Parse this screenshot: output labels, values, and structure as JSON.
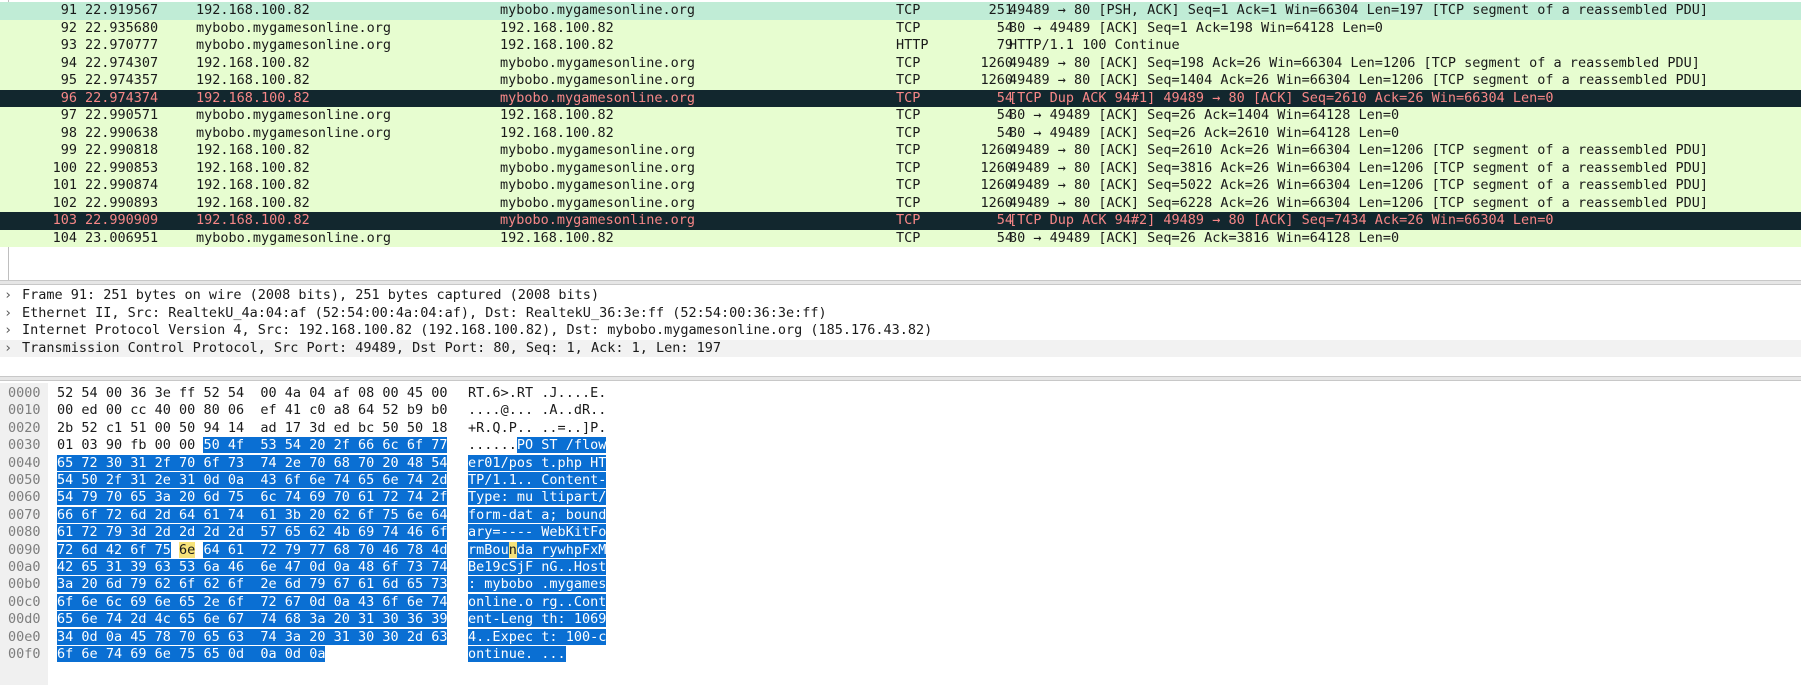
{
  "packet_list": {
    "rows": [
      {
        "no": "91",
        "time": "22.919567",
        "src": "192.168.100.82",
        "dst": "mybobo.mygamesonline.org",
        "proto": "TCP",
        "len": "251",
        "info": "49489 → 80 [PSH, ACK] Seq=1 Ack=1 Win=66304 Len=197 [TCP segment of a reassembled PDU]",
        "style": "sel"
      },
      {
        "no": "92",
        "time": "22.935680",
        "src": "mybobo.mygamesonline.org",
        "dst": "192.168.100.82",
        "proto": "TCP",
        "len": "54",
        "info": "80 → 49489 [ACK] Seq=1 Ack=198 Win=64128 Len=0",
        "style": "normal"
      },
      {
        "no": "93",
        "time": "22.970777",
        "src": "mybobo.mygamesonline.org",
        "dst": "192.168.100.82",
        "proto": "HTTP",
        "len": "79",
        "info": "HTTP/1.1 100 Continue",
        "style": "normal"
      },
      {
        "no": "94",
        "time": "22.974307",
        "src": "192.168.100.82",
        "dst": "mybobo.mygamesonline.org",
        "proto": "TCP",
        "len": "1260",
        "info": "49489 → 80 [ACK] Seq=198 Ack=26 Win=66304 Len=1206 [TCP segment of a reassembled PDU]",
        "style": "normal"
      },
      {
        "no": "95",
        "time": "22.974357",
        "src": "192.168.100.82",
        "dst": "mybobo.mygamesonline.org",
        "proto": "TCP",
        "len": "1260",
        "info": "49489 → 80 [ACK] Seq=1404 Ack=26 Win=66304 Len=1206 [TCP segment of a reassembled PDU]",
        "style": "normal"
      },
      {
        "no": "96",
        "time": "22.974374",
        "src": "192.168.100.82",
        "dst": "mybobo.mygamesonline.org",
        "proto": "TCP",
        "len": "54",
        "info": "[TCP Dup ACK 94#1] 49489 → 80 [ACK] Seq=2610 Ack=26 Win=66304 Len=0",
        "style": "bad"
      },
      {
        "no": "97",
        "time": "22.990571",
        "src": "mybobo.mygamesonline.org",
        "dst": "192.168.100.82",
        "proto": "TCP",
        "len": "54",
        "info": "80 → 49489 [ACK] Seq=26 Ack=1404 Win=64128 Len=0",
        "style": "normal"
      },
      {
        "no": "98",
        "time": "22.990638",
        "src": "mybobo.mygamesonline.org",
        "dst": "192.168.100.82",
        "proto": "TCP",
        "len": "54",
        "info": "80 → 49489 [ACK] Seq=26 Ack=2610 Win=64128 Len=0",
        "style": "normal"
      },
      {
        "no": "99",
        "time": "22.990818",
        "src": "192.168.100.82",
        "dst": "mybobo.mygamesonline.org",
        "proto": "TCP",
        "len": "1260",
        "info": "49489 → 80 [ACK] Seq=2610 Ack=26 Win=66304 Len=1206 [TCP segment of a reassembled PDU]",
        "style": "normal"
      },
      {
        "no": "100",
        "time": "22.990853",
        "src": "192.168.100.82",
        "dst": "mybobo.mygamesonline.org",
        "proto": "TCP",
        "len": "1260",
        "info": "49489 → 80 [ACK] Seq=3816 Ack=26 Win=66304 Len=1206 [TCP segment of a reassembled PDU]",
        "style": "normal"
      },
      {
        "no": "101",
        "time": "22.990874",
        "src": "192.168.100.82",
        "dst": "mybobo.mygamesonline.org",
        "proto": "TCP",
        "len": "1260",
        "info": "49489 → 80 [ACK] Seq=5022 Ack=26 Win=66304 Len=1206 [TCP segment of a reassembled PDU]",
        "style": "normal"
      },
      {
        "no": "102",
        "time": "22.990893",
        "src": "192.168.100.82",
        "dst": "mybobo.mygamesonline.org",
        "proto": "TCP",
        "len": "1260",
        "info": "49489 → 80 [ACK] Seq=6228 Ack=26 Win=66304 Len=1206 [TCP segment of a reassembled PDU]",
        "style": "normal"
      },
      {
        "no": "103",
        "time": "22.990909",
        "src": "192.168.100.82",
        "dst": "mybobo.mygamesonline.org",
        "proto": "TCP",
        "len": "54",
        "info": "[TCP Dup ACK 94#2] 49489 → 80 [ACK] Seq=7434 Ack=26 Win=66304 Len=0",
        "style": "bad"
      },
      {
        "no": "104",
        "time": "23.006951",
        "src": "mybobo.mygamesonline.org",
        "dst": "192.168.100.82",
        "proto": "TCP",
        "len": "54",
        "info": "80 → 49489 [ACK] Seq=26 Ack=3816 Win=64128 Len=0",
        "style": "normal"
      }
    ]
  },
  "details": {
    "expander_glyph": "›",
    "rows": [
      "Frame 91: 251 bytes on wire (2008 bits), 251 bytes captured (2008 bits)",
      "Ethernet II, Src: RealtekU_4a:04:af (52:54:00:4a:04:af), Dst: RealtekU_36:3e:ff (52:54:00:36:3e:ff)",
      "Internet Protocol Version 4, Src: 192.168.100.82 (192.168.100.82), Dst: mybobo.mygamesonline.org (185.176.43.82)",
      "Transmission Control Protocol, Src Port: 49489, Dst Port: 80, Seq: 1, Ack: 1, Len: 197"
    ]
  },
  "hex_dump": {
    "rows": [
      {
        "offset": "0000",
        "bytes": [
          "52",
          "54",
          "00",
          "36",
          "3e",
          "ff",
          "52",
          "54",
          "00",
          "4a",
          "04",
          "af",
          "08",
          "00",
          "45",
          "00"
        ],
        "ascii": "RT.6>.RT.J....E."
      },
      {
        "offset": "0010",
        "bytes": [
          "00",
          "ed",
          "00",
          "cc",
          "40",
          "00",
          "80",
          "06",
          "ef",
          "41",
          "c0",
          "a8",
          "64",
          "52",
          "b9",
          "b0"
        ],
        "ascii": "....@....A..dR.."
      },
      {
        "offset": "0020",
        "bytes": [
          "2b",
          "52",
          "c1",
          "51",
          "00",
          "50",
          "94",
          "14",
          "ad",
          "17",
          "3d",
          "ed",
          "bc",
          "50",
          "50",
          "18"
        ],
        "ascii": "+R.Q.P....=..]P."
      },
      {
        "offset": "0030",
        "bytes": [
          "01",
          "03",
          "90",
          "fb",
          "00",
          "00",
          "50",
          "4f",
          "53",
          "54",
          "20",
          "2f",
          "66",
          "6c",
          "6f",
          "77"
        ],
        "ascii": "......POST /flow"
      },
      {
        "offset": "0040",
        "bytes": [
          "65",
          "72",
          "30",
          "31",
          "2f",
          "70",
          "6f",
          "73",
          "74",
          "2e",
          "70",
          "68",
          "70",
          "20",
          "48",
          "54"
        ],
        "ascii": "er01/post.php HT"
      },
      {
        "offset": "0050",
        "bytes": [
          "54",
          "50",
          "2f",
          "31",
          "2e",
          "31",
          "0d",
          "0a",
          "43",
          "6f",
          "6e",
          "74",
          "65",
          "6e",
          "74",
          "2d"
        ],
        "ascii": "TP/1.1..Content-"
      },
      {
        "offset": "0060",
        "bytes": [
          "54",
          "79",
          "70",
          "65",
          "3a",
          "20",
          "6d",
          "75",
          "6c",
          "74",
          "69",
          "70",
          "61",
          "72",
          "74",
          "2f"
        ],
        "ascii": "Type: multipart/"
      },
      {
        "offset": "0070",
        "bytes": [
          "66",
          "6f",
          "72",
          "6d",
          "2d",
          "64",
          "61",
          "74",
          "61",
          "3b",
          "20",
          "62",
          "6f",
          "75",
          "6e",
          "64"
        ],
        "ascii": "form-data; bound"
      },
      {
        "offset": "0080",
        "bytes": [
          "61",
          "72",
          "79",
          "3d",
          "2d",
          "2d",
          "2d",
          "2d",
          "57",
          "65",
          "62",
          "4b",
          "69",
          "74",
          "46",
          "6f"
        ],
        "ascii": "ary=----WebKitFo"
      },
      {
        "offset": "0090",
        "bytes": [
          "72",
          "6d",
          "42",
          "6f",
          "75",
          "6e",
          "64",
          "61",
          "72",
          "79",
          "77",
          "68",
          "70",
          "46",
          "78",
          "4d"
        ],
        "ascii": "rmBoundarywhpFxM"
      },
      {
        "offset": "00a0",
        "bytes": [
          "42",
          "65",
          "31",
          "39",
          "63",
          "53",
          "6a",
          "46",
          "6e",
          "47",
          "0d",
          "0a",
          "48",
          "6f",
          "73",
          "74"
        ],
        "ascii": "Be19cSjFnG..Host"
      },
      {
        "offset": "00b0",
        "bytes": [
          "3a",
          "20",
          "6d",
          "79",
          "62",
          "6f",
          "62",
          "6f",
          "2e",
          "6d",
          "79",
          "67",
          "61",
          "6d",
          "65",
          "73"
        ],
        "ascii": ": mybobo.mygames"
      },
      {
        "offset": "00c0",
        "bytes": [
          "6f",
          "6e",
          "6c",
          "69",
          "6e",
          "65",
          "2e",
          "6f",
          "72",
          "67",
          "0d",
          "0a",
          "43",
          "6f",
          "6e",
          "74"
        ],
        "ascii": "online.org..Cont"
      },
      {
        "offset": "00d0",
        "bytes": [
          "65",
          "6e",
          "74",
          "2d",
          "4c",
          "65",
          "6e",
          "67",
          "74",
          "68",
          "3a",
          "20",
          "31",
          "30",
          "36",
          "39"
        ],
        "ascii": "ent-Length: 1069"
      },
      {
        "offset": "00e0",
        "bytes": [
          "34",
          "0d",
          "0a",
          "45",
          "78",
          "70",
          "65",
          "63",
          "74",
          "3a",
          "20",
          "31",
          "30",
          "30",
          "2d",
          "63"
        ],
        "ascii": "4..Expect: 100-c"
      },
      {
        "offset": "00f0",
        "bytes": [
          "6f",
          "6e",
          "74",
          "69",
          "6e",
          "75",
          "65",
          "0d",
          "0a",
          "0d",
          "0a"
        ],
        "ascii": "ontinue...."
      }
    ],
    "selection_start_index": 54,
    "cursor_index": 149
  }
}
